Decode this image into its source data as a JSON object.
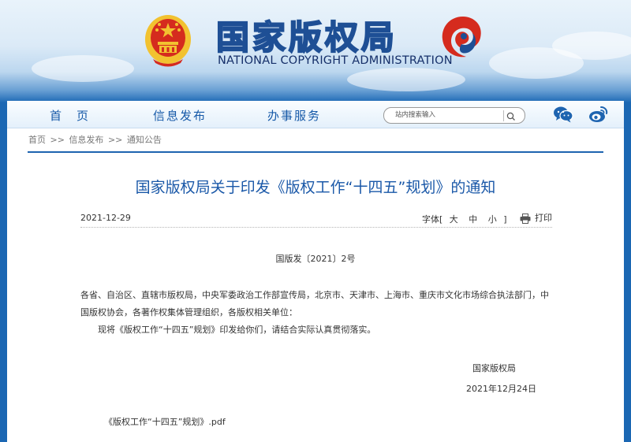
{
  "header": {
    "title_cn": "国家版权局",
    "title_en": "NATIONAL COPYRIGHT ADMINISTRATION"
  },
  "nav": {
    "items": [
      {
        "label": "首　页"
      },
      {
        "label": "信息发布"
      },
      {
        "label": "办事服务"
      }
    ],
    "search": {
      "placeholder": "站内搜索输入"
    }
  },
  "breadcrumb": {
    "items": [
      "首页",
      "信息发布",
      "通知公告"
    ],
    "separator": ">>"
  },
  "article": {
    "title": "国家版权局关于印发《版权工作“十四五”规划》的通知",
    "date": "2021-12-29",
    "font_size": {
      "label": "字体",
      "open": "[",
      "close": "]",
      "options": [
        "大",
        "中",
        "小"
      ]
    },
    "print_label": "打印",
    "doc_number": "国版发〔2021〕2号",
    "recipients": "各省、自治区、直辖市版权局，中央军委政治工作部宣传局，北京市、天津市、上海市、重庆市文化市场综合执法部门，中国版权协会，各著作权集体管理组织，各版权相关单位：",
    "body": "现将《版权工作“十四五”规划》印发给你们，请结合实际认真贯彻落实。",
    "signature": "国家版权局",
    "signed_date": "2021年12月24日",
    "attachment": "《版权工作“十四五”规划》.pdf"
  },
  "colors": {
    "page_blue": "#1b67b3",
    "title_blue": "#1a58a8",
    "nav_text": "#1659a8",
    "emblem_red": "#d52b1e",
    "emblem_gold": "#f2c230"
  }
}
